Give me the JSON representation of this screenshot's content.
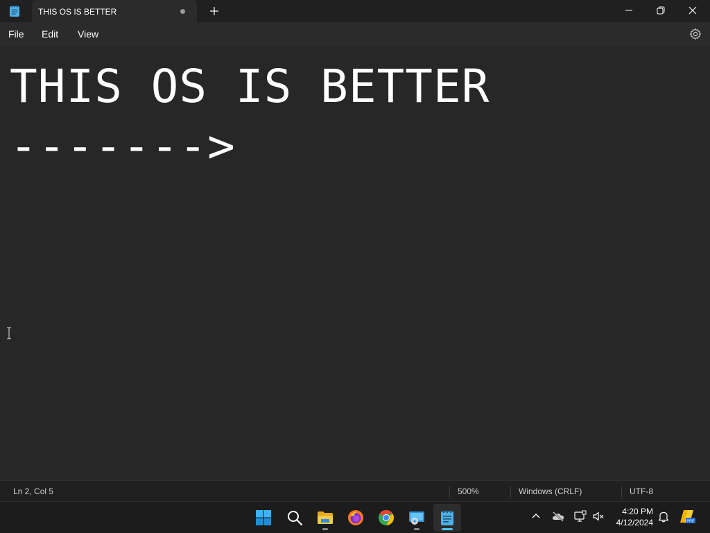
{
  "window": {
    "app_icon": "notepad-icon",
    "tab_title": "THIS OS IS BETTER",
    "tab_unsaved_indicator": "unsaved-dot-icon",
    "new_tab_icon": "plus-icon",
    "controls": [
      "minimize-icon",
      "maximize-icon",
      "close-icon"
    ]
  },
  "menu": {
    "file": "File",
    "edit": "Edit",
    "view": "View",
    "settings_icon": "gear-icon"
  },
  "editor": {
    "lines": [
      "THIS OS IS BETTER",
      "------->"
    ]
  },
  "status": {
    "position": "Ln 2, Col 5",
    "zoom": "500%",
    "line_ending": "Windows (CRLF)",
    "encoding": "UTF-8"
  },
  "taskbar": {
    "apps": [
      "windows-start-icon",
      "search-icon",
      "file-explorer-icon",
      "firefox-icon",
      "chrome-icon",
      "remote-desktop-icon",
      "notepad-icon"
    ],
    "tray": [
      "chevron-up-icon",
      "onedrive-offline-icon",
      "display-icon",
      "volume-muted-icon",
      "notification-bell-icon",
      "copilot-pre-icon"
    ],
    "time": "4:20 PM",
    "date": "4/12/2024"
  },
  "colors": {
    "background": "#202020",
    "editor_background": "#272727",
    "accent": "#4cc2ff"
  }
}
